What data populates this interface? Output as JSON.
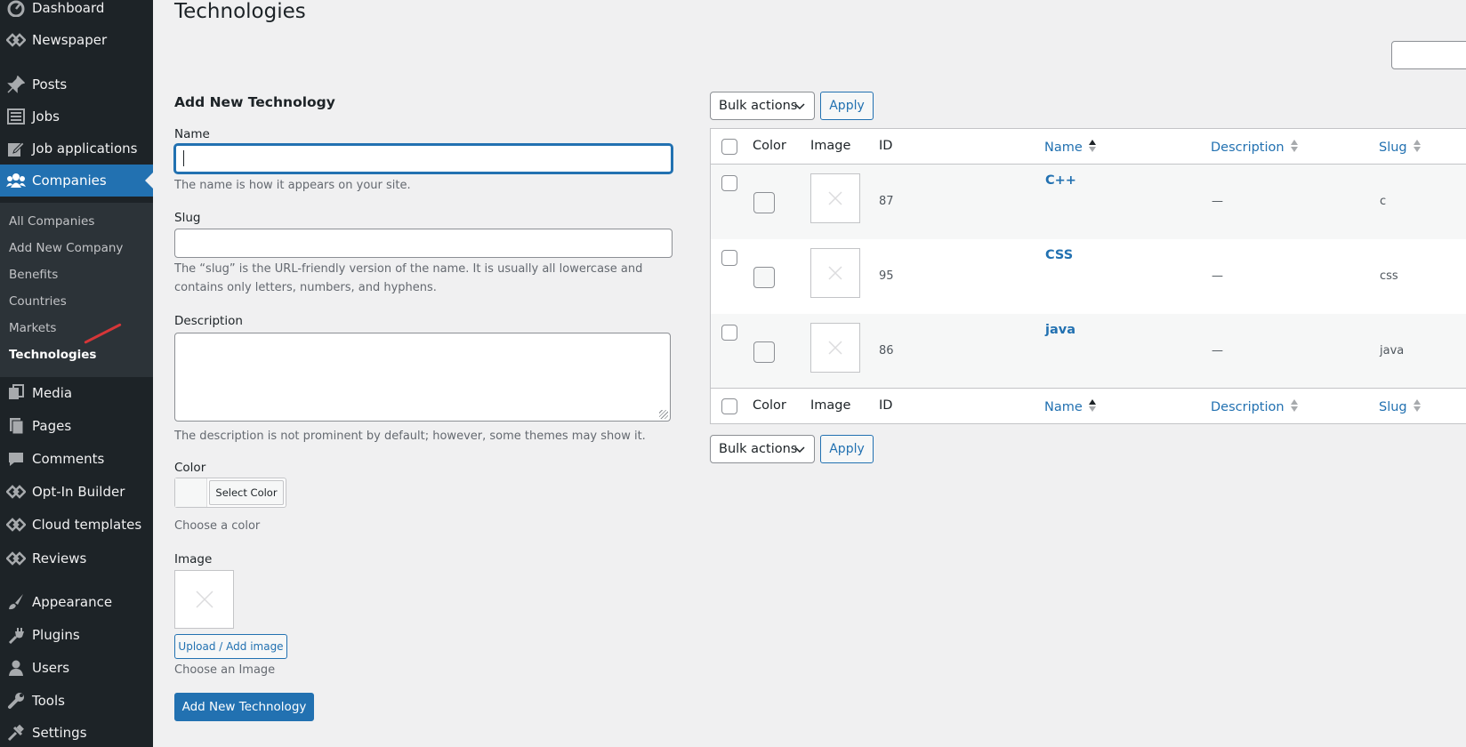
{
  "sidebar": {
    "menu": [
      {
        "label": "Dashboard",
        "icon": "dashboard-icon"
      },
      {
        "label": "Newspaper",
        "icon": "newspaper-icon"
      },
      {
        "label": "Posts",
        "icon": "pin-icon"
      },
      {
        "label": "Jobs",
        "icon": "list-icon"
      },
      {
        "label": "Job applications",
        "icon": "edit-icon"
      },
      {
        "label": "Companies",
        "icon": "groups-icon"
      },
      {
        "label": "Media",
        "icon": "media-icon"
      },
      {
        "label": "Pages",
        "icon": "pages-icon"
      },
      {
        "label": "Comments",
        "icon": "comment-icon"
      },
      {
        "label": "Opt-In Builder",
        "icon": "newspaper-icon"
      },
      {
        "label": "Cloud templates",
        "icon": "newspaper-icon"
      },
      {
        "label": "Reviews",
        "icon": "newspaper-icon"
      },
      {
        "label": "Appearance",
        "icon": "brush-icon"
      },
      {
        "label": "Plugins",
        "icon": "plug-icon"
      },
      {
        "label": "Users",
        "icon": "user-icon"
      },
      {
        "label": "Tools",
        "icon": "wrench-icon"
      },
      {
        "label": "Settings",
        "icon": "settings-icon"
      }
    ],
    "submenu": [
      {
        "label": "All Companies"
      },
      {
        "label": "Add New Company"
      },
      {
        "label": "Benefits"
      },
      {
        "label": "Countries"
      },
      {
        "label": "Markets"
      },
      {
        "label": "Technologies"
      }
    ]
  },
  "page": {
    "title": "Technologies"
  },
  "form": {
    "heading": "Add New Technology",
    "name_label": "Name",
    "name_value": "",
    "name_help": "The name is how it appears on your site.",
    "slug_label": "Slug",
    "slug_value": "",
    "slug_help": "The “slug” is the URL-friendly version of the name. It is usually all lowercase and contains only letters, numbers, and hyphens.",
    "description_label": "Description",
    "description_help": "The description is not prominent by default; however, some themes may show it.",
    "color_label": "Color",
    "select_color": "Select Color",
    "color_help": "Choose a color",
    "image_label": "Image",
    "upload_button": "Upload / Add image",
    "image_help": "Choose an Image",
    "submit_button": "Add New Technology"
  },
  "table": {
    "bulk_actions": "Bulk actions",
    "apply": "Apply",
    "columns": {
      "color": "Color",
      "image": "Image",
      "id": "ID",
      "name": "Name",
      "description": "Description",
      "slug": "Slug"
    },
    "rows": [
      {
        "id": "87",
        "name": "C++",
        "description": "—",
        "slug": "c"
      },
      {
        "id": "95",
        "name": "CSS",
        "description": "—",
        "slug": "css"
      },
      {
        "id": "86",
        "name": "java",
        "description": "—",
        "slug": "java"
      }
    ]
  },
  "colors": {
    "accent": "#2271b1",
    "sidebar_bg": "#1d2327",
    "annotation": "#d63638"
  }
}
